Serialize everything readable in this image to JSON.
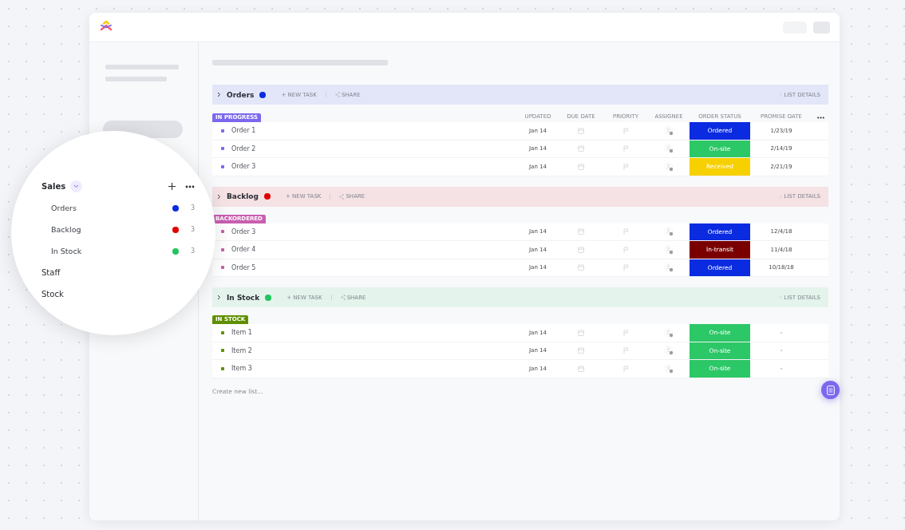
{
  "sidebar": {
    "sections": [
      {
        "label": "Sales",
        "expanded": true,
        "lists": [
          {
            "label": "Orders",
            "color": "#0a2be0",
            "count": "3"
          },
          {
            "label": "Backlog",
            "color": "#e00000",
            "count": "3"
          },
          {
            "label": "In Stock",
            "color": "#22c55e",
            "count": "3"
          }
        ]
      },
      {
        "label": "Staff",
        "expanded": false
      },
      {
        "label": "Stock",
        "expanded": false
      }
    ]
  },
  "columns": [
    "UPDATED",
    "DUE DATE",
    "PRIORITY",
    "ASSIGNEE",
    "ORDER STATUS",
    "PROMISE DATE"
  ],
  "groups": [
    {
      "title": "Orders",
      "color": "#0a2be0",
      "new_task": "+ NEW TASK",
      "share": "SHARE",
      "details": "LIST DETAILS",
      "tag": {
        "label": "IN PROGRESS",
        "color": "#7b68ee"
      },
      "rows": [
        {
          "name": "Order 1",
          "updated": "Jan 14",
          "status": {
            "label": "Ordered",
            "color": "#0a2be0"
          },
          "promise": "1/23/19"
        },
        {
          "name": "Order 2",
          "updated": "Jan 14",
          "status": {
            "label": "On-site",
            "color": "#2cc766"
          },
          "promise": "2/14/19"
        },
        {
          "name": "Order 3",
          "updated": "Jan 14",
          "status": {
            "label": "Received",
            "color": "#f7d000"
          },
          "promise": "2/21/19"
        }
      ]
    },
    {
      "title": "Backlog",
      "color": "#e00000",
      "new_task": "+ NEW TASK",
      "share": "SHARE",
      "details": "LIST DETAILS",
      "tag": {
        "label": "BACKORDERED",
        "color": "#c85fb0"
      },
      "rows": [
        {
          "name": "Order 3",
          "updated": "Jan 14",
          "status": {
            "label": "Ordered",
            "color": "#0a2be0"
          },
          "promise": "12/4/18"
        },
        {
          "name": "Order 4",
          "updated": "Jan 14",
          "status": {
            "label": "In-transit",
            "color": "#7a0000"
          },
          "promise": "11/4/18"
        },
        {
          "name": "Order 5",
          "updated": "Jan 14",
          "status": {
            "label": "Ordered",
            "color": "#0a2be0"
          },
          "promise": "10/18/18"
        }
      ]
    },
    {
      "title": "In Stock",
      "color": "#22c55e",
      "new_task": "+ NEW TASK",
      "share": "SHARE",
      "details": "LIST DETAILS",
      "tag": {
        "label": "IN STOCK",
        "color": "#5f8f00"
      },
      "rows": [
        {
          "name": "Item 1",
          "updated": "Jan 14",
          "status": {
            "label": "On-site",
            "color": "#2cc766"
          },
          "promise": "-"
        },
        {
          "name": "Item 2",
          "updated": "Jan 14",
          "status": {
            "label": "On-site",
            "color": "#2cc766"
          },
          "promise": "-"
        },
        {
          "name": "Item 3",
          "updated": "Jan 14",
          "status": {
            "label": "On-site",
            "color": "#2cc766"
          },
          "promise": "-"
        }
      ]
    }
  ],
  "create_list": {
    "placeholder": "Create new list..."
  }
}
